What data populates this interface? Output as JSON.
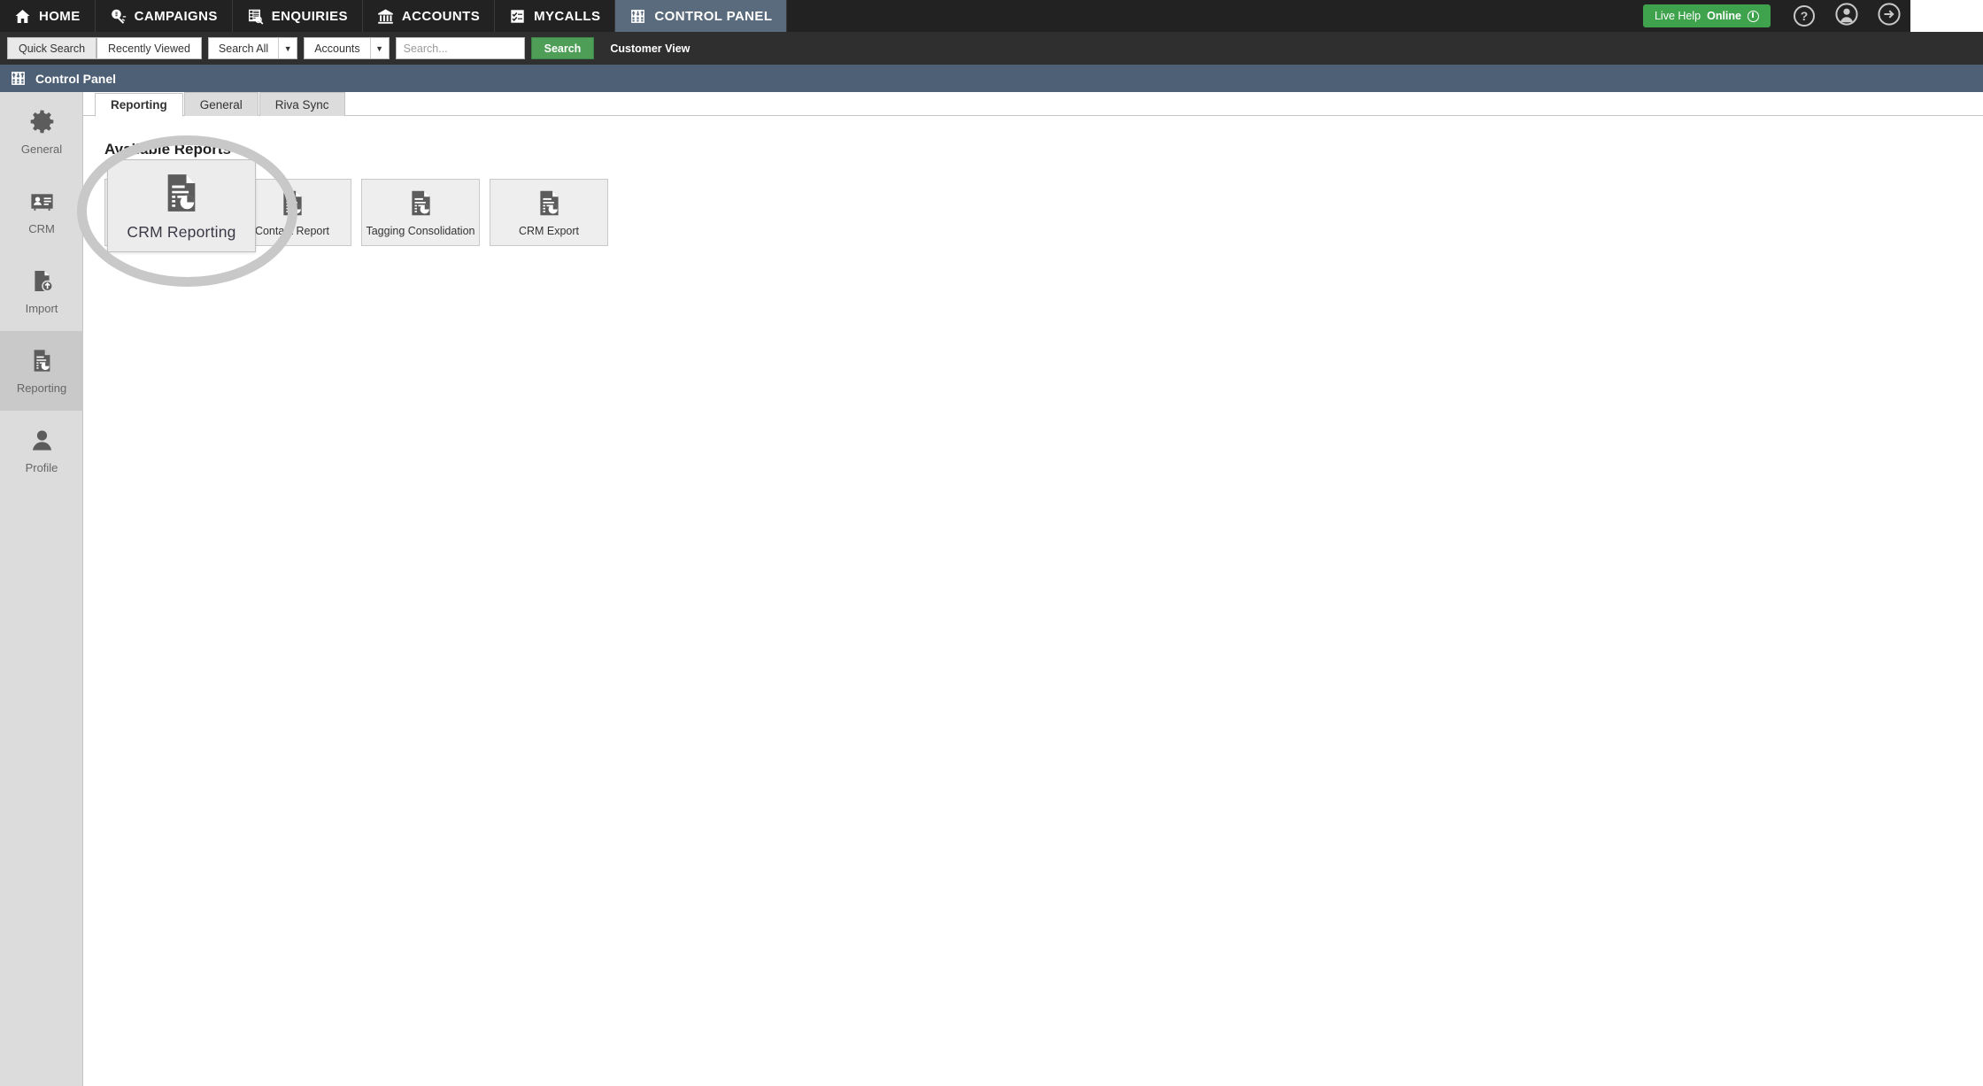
{
  "topnav": {
    "items": [
      {
        "label": "HOME",
        "icon": "home-icon",
        "active": false
      },
      {
        "label": "CAMPAIGNS",
        "icon": "megaphone-icon",
        "active": false
      },
      {
        "label": "ENQUIRIES",
        "icon": "enquiries-list-icon",
        "active": false
      },
      {
        "label": "ACCOUNTS",
        "icon": "bank-icon",
        "active": false
      },
      {
        "label": "MYCALLS",
        "icon": "checklist-icon",
        "active": false
      },
      {
        "label": "CONTROL PANEL",
        "icon": "control-panel-grid-icon",
        "active": true
      }
    ],
    "live_help": {
      "prefix": "Live Help",
      "status": "Online"
    },
    "help_icon_label": "?",
    "account_icon": "user-avatar-icon",
    "logout_icon": "logout-arrow-icon"
  },
  "search": {
    "quick_search_label": "Quick Search",
    "recently_viewed_label": "Recently Viewed",
    "scope_label": "Search All",
    "entity_label": "Accounts",
    "input_value": "",
    "placeholder": "Search...",
    "search_button_label": "Search",
    "customer_view_label": "Customer View"
  },
  "page": {
    "title": "Control Panel",
    "title_icon": "control-panel-grid-icon"
  },
  "sidebar": {
    "items": [
      {
        "label": "General",
        "icon": "gear-icon",
        "active": false
      },
      {
        "label": "CRM",
        "icon": "contact-card-icon",
        "active": false
      },
      {
        "label": "Import",
        "icon": "file-import-icon",
        "active": false
      },
      {
        "label": "Reporting",
        "icon": "report-chart-icon",
        "active": true
      },
      {
        "label": "Profile",
        "icon": "user-profile-icon",
        "active": false
      }
    ]
  },
  "tabs": [
    {
      "label": "Reporting",
      "active": true
    },
    {
      "label": "General",
      "active": false
    },
    {
      "label": "Riva Sync",
      "active": false
    }
  ],
  "main": {
    "section_title": "Available Reports",
    "tiles": [
      {
        "label": "CRM Reporting",
        "icon": "report-chart-icon"
      },
      {
        "label": "Contact Report",
        "icon": "report-chart-icon"
      },
      {
        "label": "Tagging Consolidation",
        "icon": "report-chart-icon"
      },
      {
        "label": "CRM Export",
        "icon": "report-chart-icon"
      }
    ],
    "magnified_tile": {
      "label": "CRM Reporting",
      "icon": "report-chart-icon"
    }
  },
  "colors": {
    "topnav_bg": "#222222",
    "active_nav": "#5a6b7d",
    "titlebar_bg": "#4e6076",
    "accent_green": "#4f9e58",
    "sidebar_bg": "#dcdcdc",
    "tile_bg": "#eeeeee",
    "annotation_ring": "#c8c8c8"
  }
}
